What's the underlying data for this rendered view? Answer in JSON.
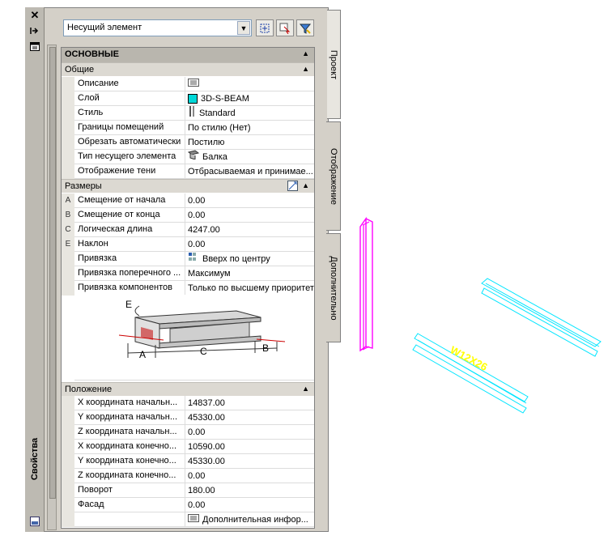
{
  "palette": {
    "title": "Свойства",
    "object_type": "Несущий элемент"
  },
  "tabs": [
    "Проект",
    "Отображение",
    "Дополнительно"
  ],
  "sections": {
    "main": "ОСНОВНЫЕ",
    "general": "Общие",
    "dimensions": "Размеры",
    "location": "Положение"
  },
  "general_rows": [
    {
      "name": "Описание",
      "value": ""
    },
    {
      "name": "Слой",
      "value": "3D-S-BEAM"
    },
    {
      "name": "Стиль",
      "value": "Standard"
    },
    {
      "name": "Границы помещений",
      "value": "По стилю (Нет)"
    },
    {
      "name": "Обрезать автоматически",
      "value": "Постилю"
    },
    {
      "name": "Тип несущего элемента",
      "value": "Балка"
    },
    {
      "name": "Отображение тени",
      "value": "Отбрасываемая и принимае..."
    }
  ],
  "dimension_rows": [
    {
      "key": "A",
      "name": "Смещение от начала",
      "value": "0.00"
    },
    {
      "key": "B",
      "name": "Смещение от конца",
      "value": "0.00"
    },
    {
      "key": "C",
      "name": "Логическая длина",
      "value": "4247.00"
    },
    {
      "key": "E",
      "name": "Наклон",
      "value": "0.00"
    },
    {
      "key": "",
      "name": "Привязка",
      "value": "Вверх по центру"
    },
    {
      "key": "",
      "name": "Привязка поперечного ...",
      "value": "Максимум"
    },
    {
      "key": "",
      "name": "Привязка компонентов",
      "value": "Только по высшему приоритету"
    }
  ],
  "diagram_labels": [
    "E",
    "A",
    "C",
    "B"
  ],
  "location_rows": [
    {
      "name": "X координата начальн...",
      "value": "14837.00"
    },
    {
      "name": "Y координата начальн...",
      "value": "45330.00"
    },
    {
      "name": "Z координата начальн...",
      "value": "0.00"
    },
    {
      "name": "X координата конечно...",
      "value": "10590.00"
    },
    {
      "name": "Y координата конечно...",
      "value": "45330.00"
    },
    {
      "name": "Z координата конечно...",
      "value": "0.00"
    },
    {
      "name": "Поворот",
      "value": "180.00"
    },
    {
      "name": "Фасад",
      "value": "0.00"
    },
    {
      "name": "",
      "value": "Дополнительная инфор..."
    }
  ],
  "canvas": {
    "beam_label": "W12X26"
  },
  "colors": {
    "layer_swatch": "#00d8d8",
    "magenta_beam": "#ff00ff",
    "cyan_beam": "#00e5ff",
    "label_yellow": "#ffff00"
  }
}
